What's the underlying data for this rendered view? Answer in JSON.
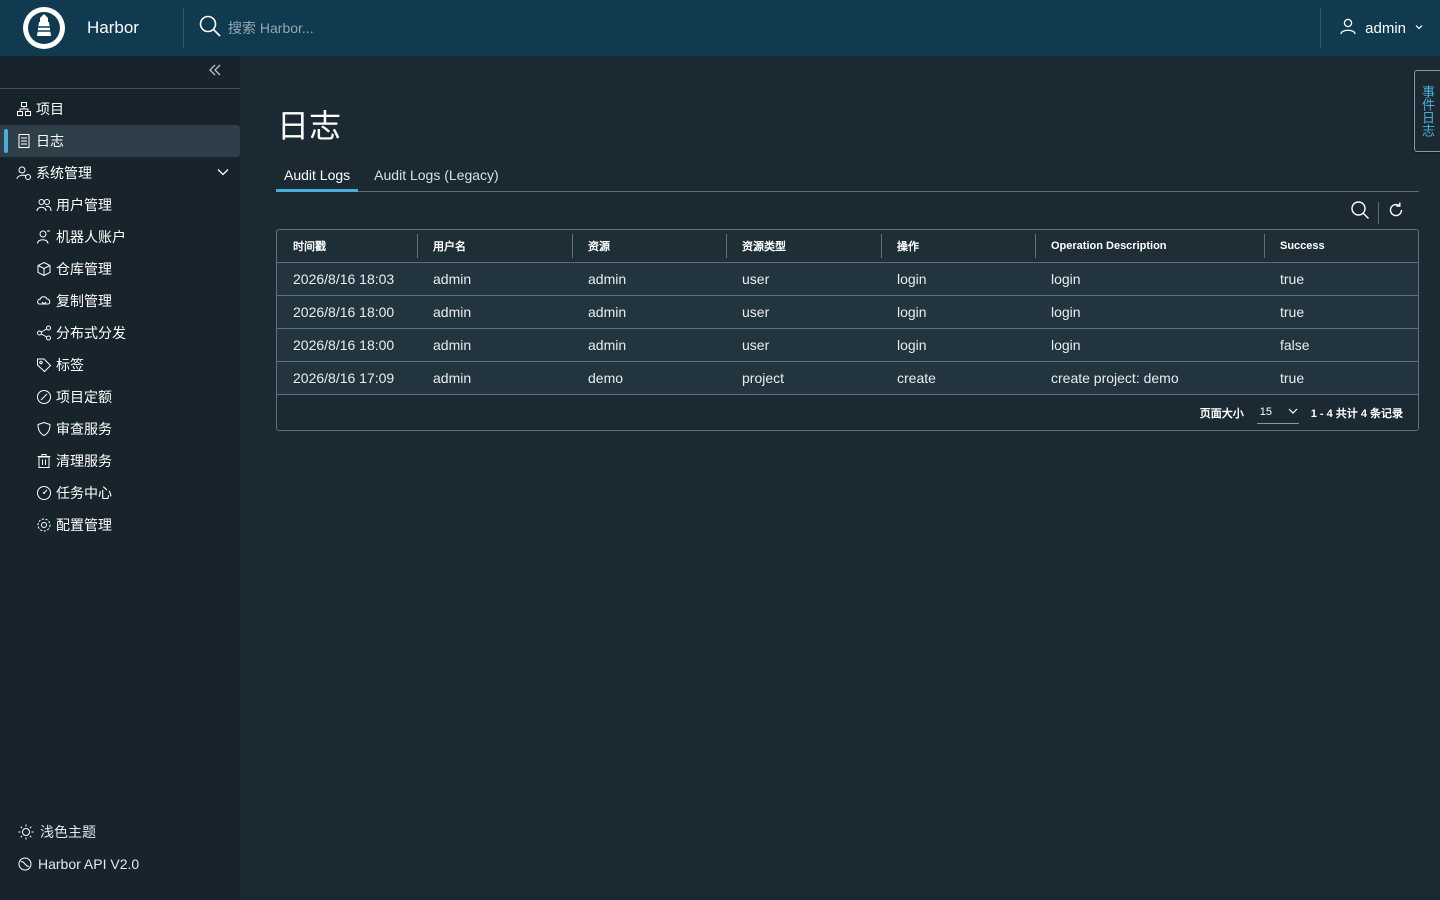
{
  "app": {
    "brand": "Harbor"
  },
  "search": {
    "placeholder": "搜索 Harbor..."
  },
  "user": {
    "name": "admin"
  },
  "sidebar": {
    "items": [
      {
        "label": "项目",
        "icon": "project-icon"
      },
      {
        "label": "日志",
        "icon": "log-icon",
        "active": true
      },
      {
        "label": "系统管理",
        "icon": "admin-icon",
        "expanded": true
      }
    ],
    "sub_items": [
      {
        "label": "用户管理",
        "icon": "users-icon"
      },
      {
        "label": "机器人账户",
        "icon": "robot-icon"
      },
      {
        "label": "仓库管理",
        "icon": "registry-icon"
      },
      {
        "label": "复制管理",
        "icon": "replication-icon"
      },
      {
        "label": "分布式分发",
        "icon": "share-icon"
      },
      {
        "label": "标签",
        "icon": "tag-icon"
      },
      {
        "label": "项目定额",
        "icon": "quota-icon"
      },
      {
        "label": "审查服务",
        "icon": "shield-icon"
      },
      {
        "label": "清理服务",
        "icon": "trash-icon"
      },
      {
        "label": "任务中心",
        "icon": "dashboard-icon"
      },
      {
        "label": "配置管理",
        "icon": "gear-icon"
      }
    ],
    "footer": {
      "theme_label": "浅色主题",
      "api_label": "Harbor API V2.0"
    }
  },
  "page": {
    "title": "日志",
    "tabs": [
      {
        "label": "Audit Logs",
        "active": true
      },
      {
        "label": "Audit Logs (Legacy)",
        "active": false
      }
    ]
  },
  "table": {
    "columns": [
      "时间戳",
      "用户名",
      "资源",
      "资源类型",
      "操作",
      "Operation Description",
      "Success"
    ],
    "rows": [
      [
        "2026/8/16 18:03",
        "admin",
        "admin",
        "user",
        "login",
        "login",
        "true"
      ],
      [
        "2026/8/16 18:00",
        "admin",
        "admin",
        "user",
        "login",
        "login",
        "true"
      ],
      [
        "2026/8/16 18:00",
        "admin",
        "admin",
        "user",
        "login",
        "login",
        "false"
      ],
      [
        "2026/8/16 17:09",
        "admin",
        "demo",
        "project",
        "create",
        "create project: demo",
        "true"
      ]
    ]
  },
  "pagination": {
    "page_size_label": "页面大小",
    "page_size": "15",
    "range_text": "1 - 4 共计 4 条记录"
  },
  "event_log_tab": "事件日志",
  "colors": {
    "accent": "#49afd9",
    "header_bg": "#0f3a4f",
    "sidebar_bg": "#17242b",
    "content_bg": "#1b2a32"
  }
}
